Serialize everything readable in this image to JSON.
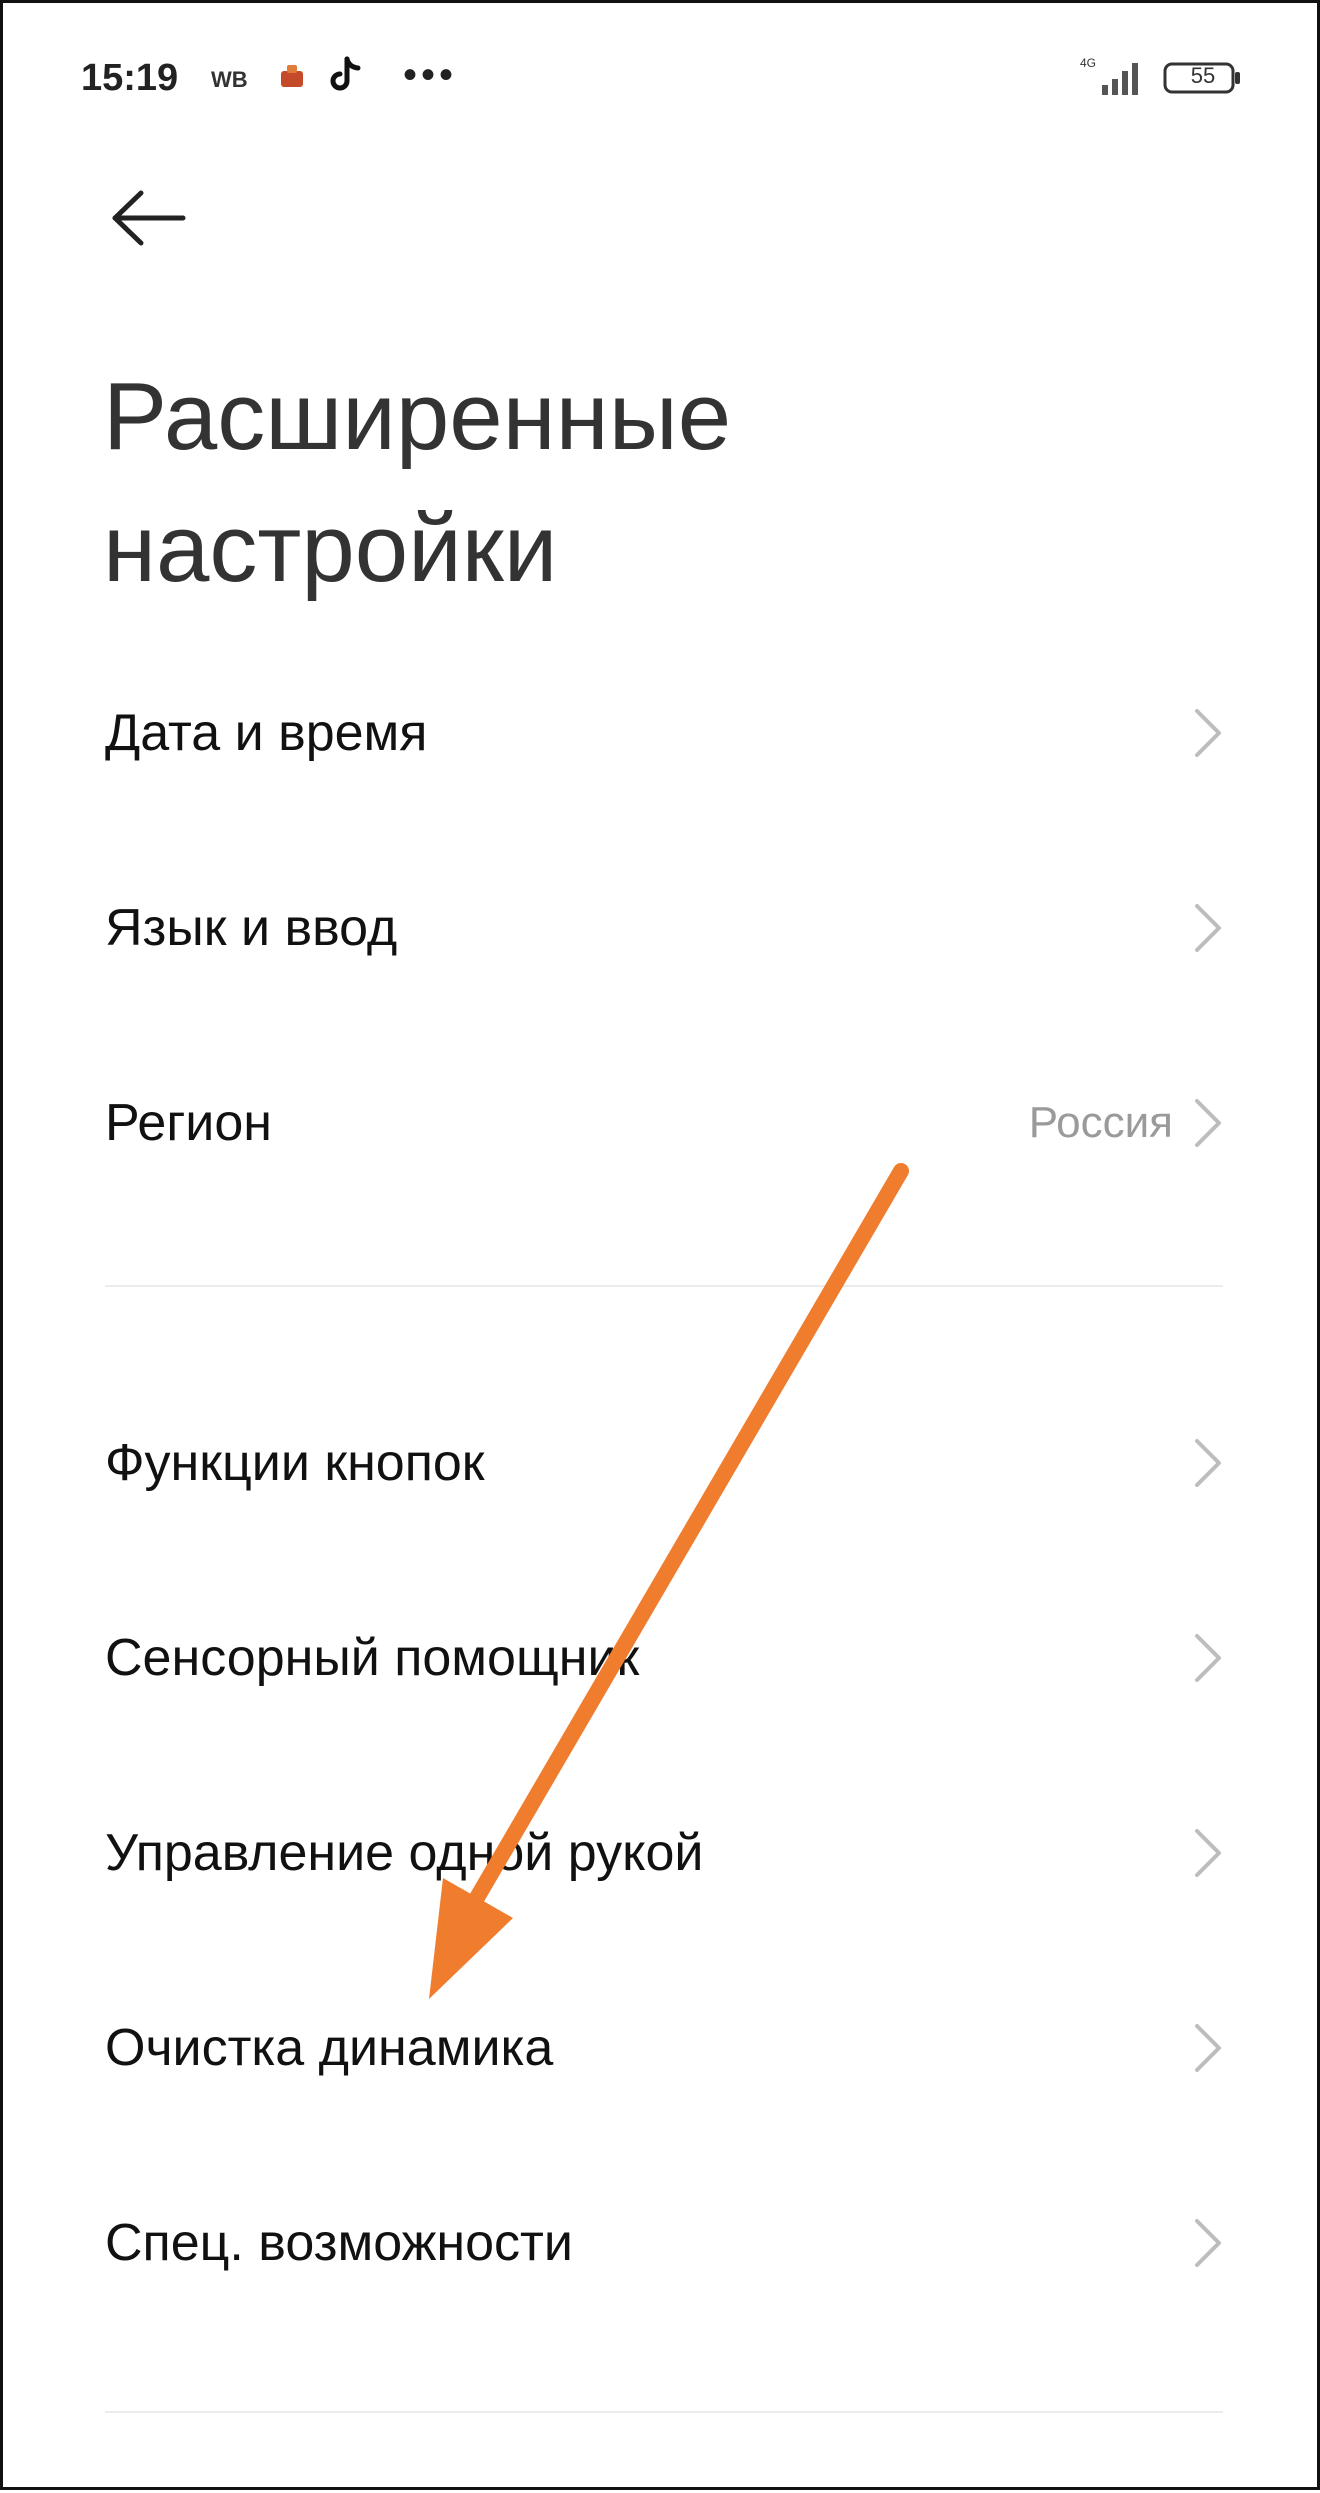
{
  "status_bar": {
    "time": "15:19",
    "wb": "WB",
    "network": "4G",
    "battery": "55"
  },
  "header": {
    "title_line1": "Расширенные",
    "title_line2": "настройки"
  },
  "menu": {
    "group1": [
      {
        "label": "Дата и время",
        "value": ""
      },
      {
        "label": "Язык и ввод",
        "value": ""
      },
      {
        "label": "Регион",
        "value": "Россия"
      }
    ],
    "group2": [
      {
        "label": "Функции кнопок"
      },
      {
        "label": "Сенсорный помощник"
      },
      {
        "label": "Управление одной рукой"
      },
      {
        "label": "Очистка динамика"
      },
      {
        "label": "Спец. возможности"
      }
    ]
  },
  "colors": {
    "annotation_arrow": "#f07d2e",
    "text": "#111111",
    "secondary_text": "#9a9a9a",
    "chevron": "#bdbdbd"
  },
  "icons": {
    "back": "arrow-left-icon",
    "chevron": "chevron-right-icon",
    "tiktok": "tiktok-icon",
    "more": "more-dots-icon",
    "signal": "signal-icon",
    "battery": "battery-icon"
  }
}
